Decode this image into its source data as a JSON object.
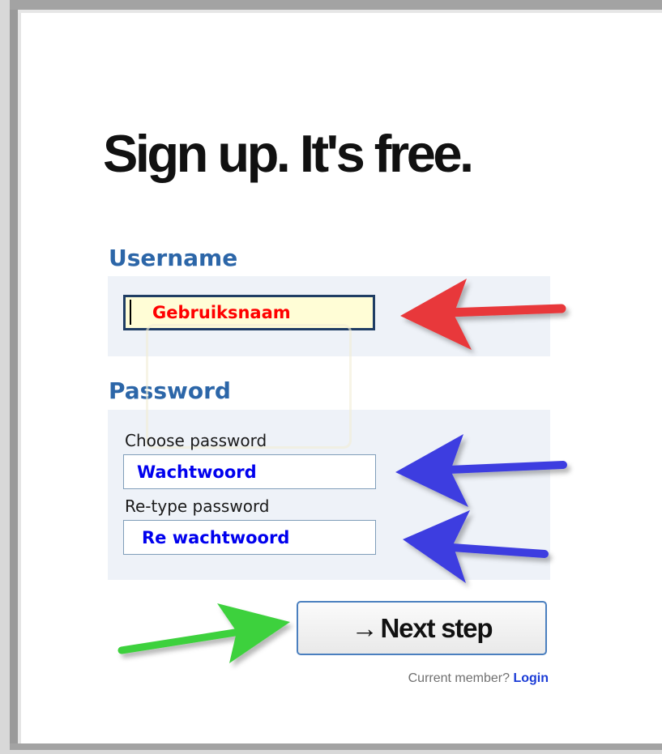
{
  "headline": "Sign up. It's free.",
  "username_section": {
    "title": "Username",
    "input_value": "Gebruiksnaam"
  },
  "password_section": {
    "title": "Password",
    "choose_label": "Choose password",
    "choose_value": "Wachtwoord",
    "retype_label": "Re-type password",
    "retype_value": "Re wachtwoord"
  },
  "next_button": {
    "arrow": "→",
    "label": "Next step"
  },
  "member_prompt": {
    "text": "Current member?",
    "login_label": "Login"
  },
  "annotations": [
    {
      "name": "username-arrow",
      "color": "#e8393b"
    },
    {
      "name": "password-arrow",
      "color": "#3e3ee0"
    },
    {
      "name": "retype-arrow",
      "color": "#3e3ee0"
    },
    {
      "name": "next-step-arrow",
      "color": "#3ed13e"
    }
  ],
  "colors": {
    "section_title": "#2c66a8",
    "panel_bg": "#eef2f8",
    "username_text": "#ff0000",
    "password_text": "#0000ee",
    "login_link": "#1a3bd6"
  }
}
